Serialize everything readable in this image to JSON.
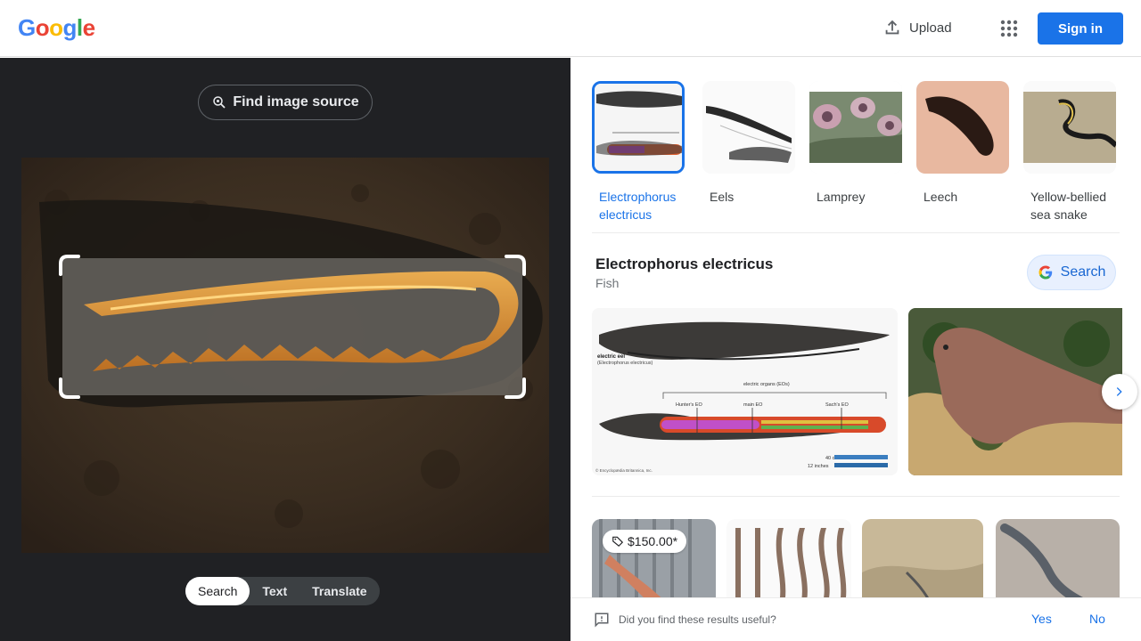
{
  "header": {
    "logo_letters": [
      "G",
      "o",
      "o",
      "g",
      "l",
      "e"
    ],
    "upload_label": "Upload",
    "apps_icon": "apps-grid-icon",
    "signin_label": "Sign in",
    "colors": {
      "brand_blue": "#1a73e8"
    }
  },
  "left_panel": {
    "find_source_label": "Find image source",
    "mode_tabs": [
      {
        "label": "Search",
        "active": true
      },
      {
        "label": "Text",
        "active": false
      },
      {
        "label": "Translate",
        "active": false
      }
    ]
  },
  "results": {
    "chips": [
      {
        "label_line1": "Electrophorus",
        "label_line2": "electricus",
        "selected": true
      },
      {
        "label_line1": "Eels",
        "label_line2": "",
        "selected": false
      },
      {
        "label_line1": "Lamprey",
        "label_line2": "",
        "selected": false
      },
      {
        "label_line1": "Leech",
        "label_line2": "",
        "selected": false
      },
      {
        "label_line1": "Yellow-bellied",
        "label_line2": "sea snake",
        "selected": false
      }
    ],
    "knowledge": {
      "title": "Electrophorus electricus",
      "subtitle": "Fish",
      "search_label": "Search",
      "diagram": {
        "label_main": "electric eel",
        "label_sci": "(Electrophorus electricus)",
        "organs_label": "electric organs (EOs)",
        "hunters": "Hunter's EO",
        "main": "main EO",
        "sachs": "Sach's EO",
        "scale_cm": "40 cm",
        "scale_in": "12 inches",
        "credit": "© Encyclopædia Britannica, Inc."
      }
    },
    "price_tag": "$150.00*"
  },
  "feedback": {
    "question": "Did you find these results useful?",
    "yes_label": "Yes",
    "no_label": "No"
  }
}
